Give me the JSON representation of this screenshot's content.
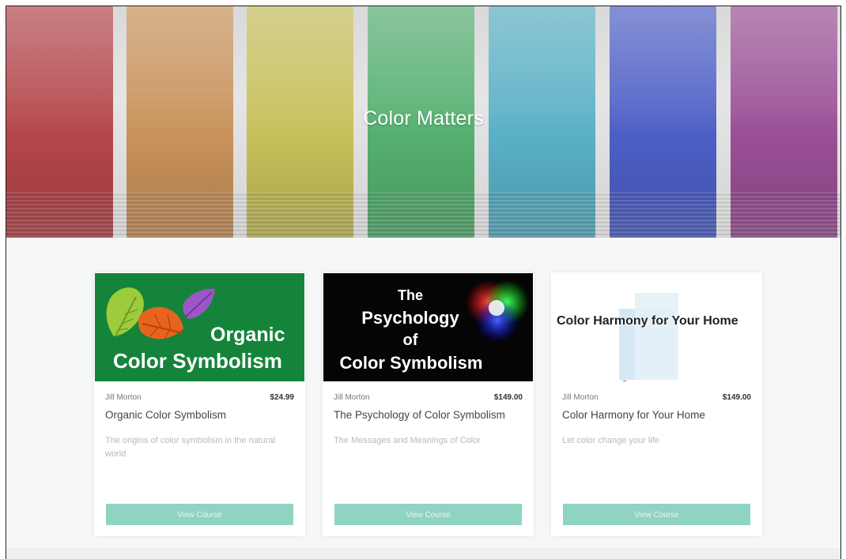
{
  "hero": {
    "title": "Color Matters",
    "panel_colors": [
      "#b4464a",
      "#c9925a",
      "#c8c05a",
      "#55b070",
      "#59b1c6",
      "#4d5fc7",
      "#9a4f96"
    ]
  },
  "courses": [
    {
      "image_text": [
        "Organic",
        "Color Symbolism"
      ],
      "author": "Jill Morton",
      "price": "$24.99",
      "title": "Organic Color Symbolism",
      "description": "The origins of color symbolism in the natural world",
      "button_label": "View Course"
    },
    {
      "image_text": [
        "The",
        "Psychology",
        "of",
        "Color Symbolism"
      ],
      "author": "Jill Morton",
      "price": "$149.00",
      "title": "The Psychology of Color Symbolism",
      "description": "The Messages and Meanings of Color",
      "button_label": "View Course"
    },
    {
      "image_text": [
        "Color Harmony for Your Home"
      ],
      "author": "Jill Morton",
      "price": "$149.00",
      "title": "Color Harmony for Your Home",
      "description": "Let color change your life",
      "button_label": "View Course"
    }
  ],
  "colors": {
    "button": "#8fd3c3",
    "card_image_green": "#14843b",
    "card_image_black": "#050505"
  }
}
